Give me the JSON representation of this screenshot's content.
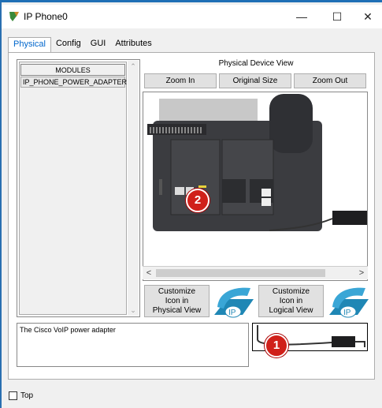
{
  "window": {
    "title": "IP Phone0"
  },
  "titlebar": {
    "minimize": "—",
    "maximize": "☐",
    "close": "✕"
  },
  "tabs": [
    {
      "label": "Physical",
      "active": true
    },
    {
      "label": "Config",
      "active": false
    },
    {
      "label": "GUI",
      "active": false
    },
    {
      "label": "Attributes",
      "active": false
    }
  ],
  "modules": {
    "header": "MODULES",
    "items": [
      "IP_PHONE_POWER_ADAPTER"
    ]
  },
  "physical_view": {
    "title": "Physical Device View",
    "zoom_in": "Zoom In",
    "original_size": "Original Size",
    "zoom_out": "Zoom Out"
  },
  "customize": {
    "physical_line1": "Customize",
    "physical_line2": "Icon in",
    "physical_line3": "Physical View",
    "logical_line1": "Customize",
    "logical_line2": "Icon in",
    "logical_line3": "Logical View",
    "ip_label": "IP"
  },
  "description": "The Cisco VoIP power adapter",
  "badges": {
    "one": "1",
    "two": "2"
  },
  "top_checkbox": {
    "label": "Top",
    "checked": false
  },
  "colors": {
    "accent_tab": "#0066cc",
    "badge": "#d0201a",
    "titlebar_edge": "#1f6fb5"
  }
}
